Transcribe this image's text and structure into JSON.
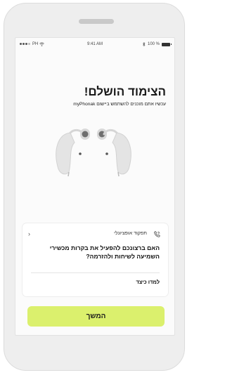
{
  "statusbar": {
    "carrier": "PH",
    "time": "9:41 AM",
    "battery": "100 %"
  },
  "title": "הצימוד הושלם!",
  "subtitle": "עכשיו אתם מוכנים להשתמש ביישום myPhonak",
  "card": {
    "label": "תפקוד אופציונלי",
    "question": "האם ברצונכם להפעיל את בקרות מכשירי השמיעה לשיחות ולהזרמה?",
    "link": "למדו כיצד"
  },
  "continue_button": "המשך",
  "colors": {
    "accent": "#dbf06d",
    "device_body": "#e6e6e6",
    "device_dark": "#7a7a7a"
  },
  "icons": [
    "signal-dots-icon",
    "wifi-icon",
    "bluetooth-icon",
    "battery-icon",
    "chevron-left-icon",
    "phone-call-icon"
  ]
}
